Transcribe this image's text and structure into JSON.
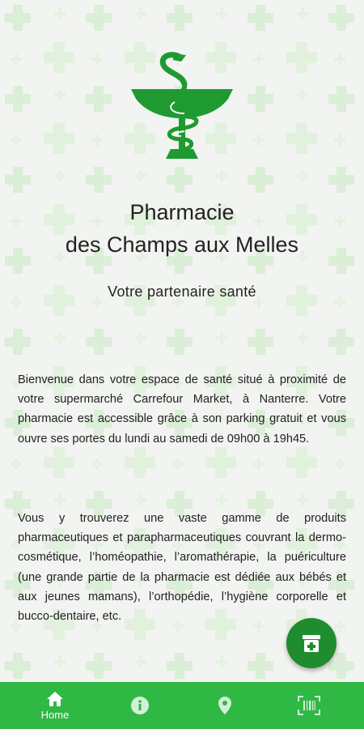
{
  "app": {
    "title_line1": "Pharmacie",
    "title_line2": "des Champs aux Melles",
    "subtitle": "Votre partenaire santé"
  },
  "logo": {
    "icon": "bowl-of-hygieia-icon",
    "color": "#1f9a31"
  },
  "main": {
    "paragraph1": "Bienvenue dans votre espace de santé situé à proximité de votre supermarché Carrefour Market, à Nanterre. Votre pharmacie est accessible grâce à son parking gratuit et vous ouvre ses portes du lundi au samedi de 09h00 à 19h45.",
    "paragraph2": "Vous y trouverez une vaste gamme de produits pharmaceutiques et parapharmaceutiques couvrant la dermo-cosmétique, l’homéopathie, l’aromathérapie, la puériculture (une grande partie de la pharmacie est dédiée aux bébés et aux jeunes mamans), l’orthopédie, l’hygiène corporelle et bucco-dentaire, etc."
  },
  "fab": {
    "icon": "prescription-icon",
    "color": "#1f8c2f"
  },
  "navbar": {
    "color": "#2fb844",
    "items": [
      {
        "icon": "home-icon",
        "label": "Home",
        "active": true
      },
      {
        "icon": "info-icon",
        "label": "",
        "active": false
      },
      {
        "icon": "location-pin-icon",
        "label": "",
        "active": false
      },
      {
        "icon": "barcode-scan-icon",
        "label": "",
        "active": false
      }
    ]
  },
  "colors": {
    "background": "#f2f4f1",
    "pattern": "#d9ecd6",
    "accent": "#2fb844"
  }
}
